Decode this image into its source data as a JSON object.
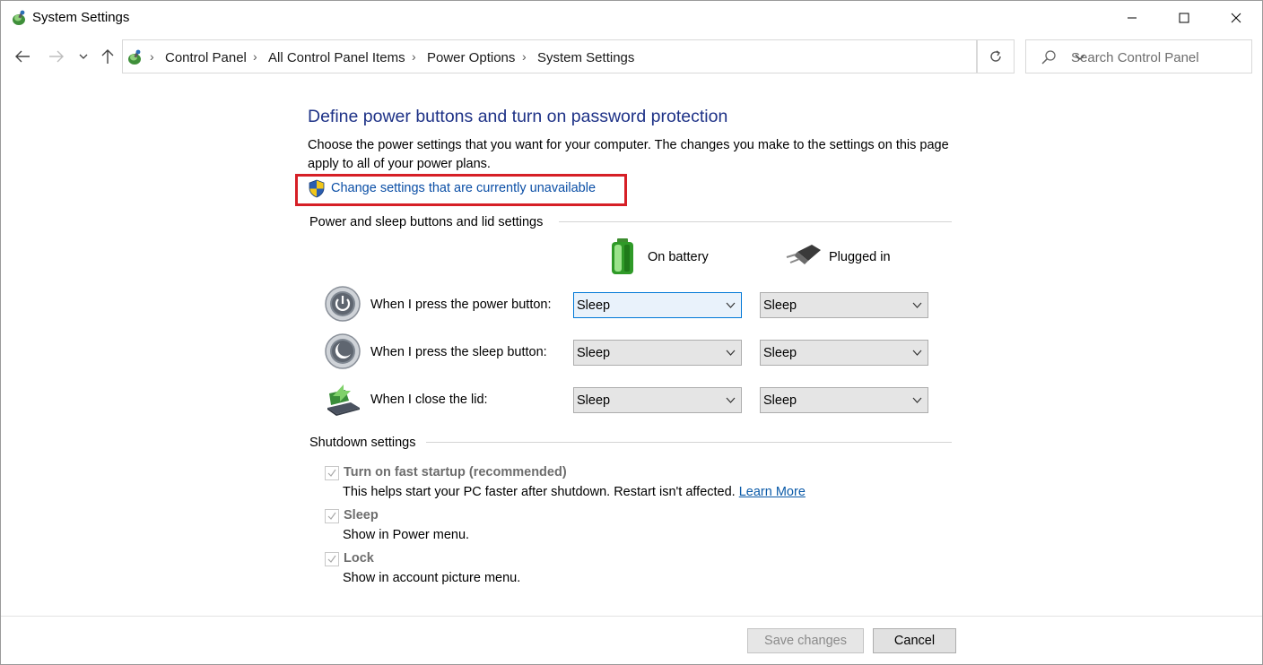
{
  "window": {
    "title": "System Settings"
  },
  "titlebar_icons": {
    "app": "control-panel-icon",
    "minimize": "minimize-icon",
    "maximize": "maximize-icon",
    "close": "close-icon"
  },
  "nav": {
    "breadcrumbs": [
      "Control Panel",
      "All Control Panel Items",
      "Power Options",
      "System Settings"
    ],
    "search_placeholder": "Search Control Panel"
  },
  "page": {
    "heading": "Define power buttons and turn on password protection",
    "description": "Choose the power settings that you want for your computer. The changes you make to the settings on this page apply to all of your power plans.",
    "change_link": "Change settings that are currently unavailable"
  },
  "buttons_section": {
    "label": "Power and sleep buttons and lid settings",
    "col_battery": "On battery",
    "col_plugged": "Plugged in",
    "rows": [
      {
        "label": "When I press the power button:",
        "battery": "Sleep",
        "plugged": "Sleep",
        "icon": "power-button-icon"
      },
      {
        "label": "When I press the sleep button:",
        "battery": "Sleep",
        "plugged": "Sleep",
        "icon": "sleep-button-icon"
      },
      {
        "label": "When I close the lid:",
        "battery": "Sleep",
        "plugged": "Sleep",
        "icon": "laptop-lid-icon"
      }
    ]
  },
  "shutdown_section": {
    "label": "Shutdown settings",
    "options": [
      {
        "title": "Turn on fast startup (recommended)",
        "desc": "This helps start your PC faster after shutdown. Restart isn't affected. ",
        "link": "Learn More",
        "checked": true
      },
      {
        "title": "Sleep",
        "desc": "Show in Power menu.",
        "checked": true
      },
      {
        "title": "Lock",
        "desc": "Show in account picture menu.",
        "checked": true
      }
    ]
  },
  "footer": {
    "save": "Save changes",
    "cancel": "Cancel"
  },
  "colors": {
    "heading": "#1e3287",
    "link": "#0b4fa6",
    "highlight": "#d61f26"
  }
}
